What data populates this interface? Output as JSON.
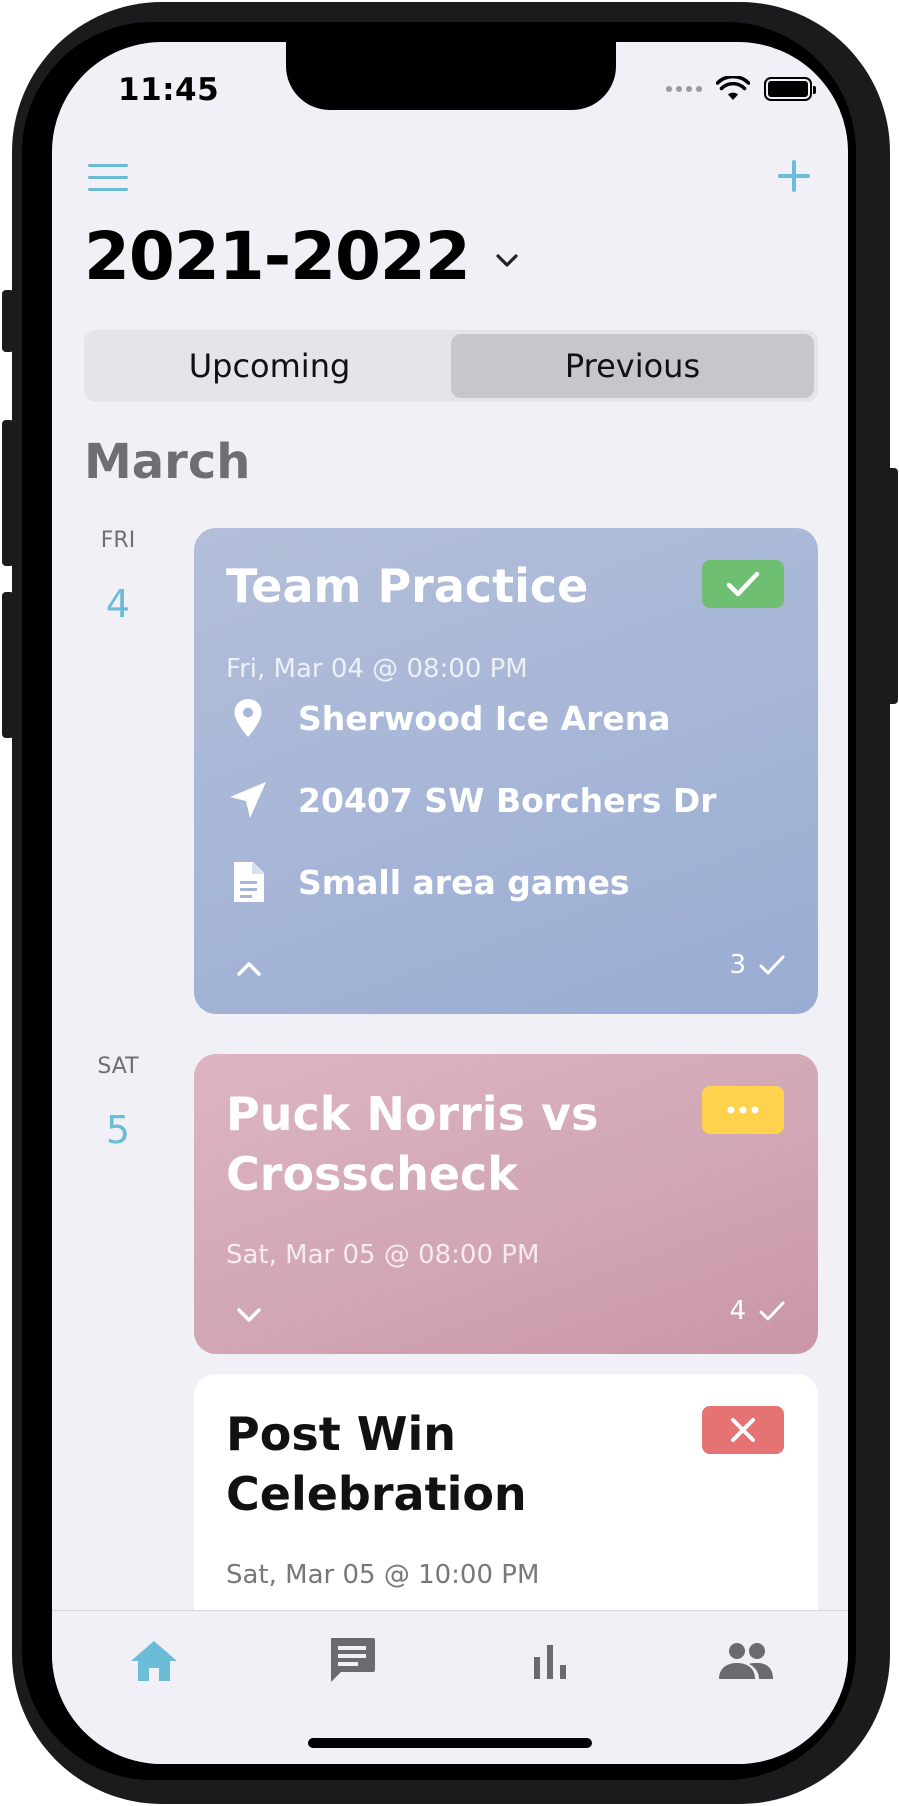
{
  "status_bar": {
    "time": "11:45"
  },
  "header": {
    "season": "2021-2022"
  },
  "segments": {
    "upcoming": "Upcoming",
    "previous": "Previous",
    "selected": "Previous"
  },
  "month": "March",
  "days": [
    {
      "dow": "FRI",
      "day": "4"
    },
    {
      "dow": "SAT",
      "day": "5"
    }
  ],
  "events": [
    {
      "title": "Team Practice",
      "datetime": "Fri, Mar 04 @ 08:00 PM",
      "status": "attending",
      "location": "Sherwood Ice Arena",
      "address": "20407 SW Borchers Dr",
      "notes": "Small area games",
      "count": "3",
      "expanded": true
    },
    {
      "title_line1": "Puck Norris vs",
      "title_line2": "Crosscheck",
      "datetime": "Sat, Mar 05 @ 08:00 PM",
      "status": "pending",
      "count": "4",
      "expanded": false
    },
    {
      "title_line1": "Post Win",
      "title_line2": "Celebration",
      "datetime": "Sat, Mar 05 @ 10:00 PM",
      "status": "declined"
    }
  ],
  "colors": {
    "accent": "#6bbcd6",
    "attending": "#6fbf73",
    "pending": "#ffd24d",
    "declined": "#e57373",
    "practice_card": "#a7b6d7",
    "game_card": "#d1a5b3"
  },
  "tabs": [
    {
      "icon": "home-icon",
      "active": true
    },
    {
      "icon": "chat-icon",
      "active": false
    },
    {
      "icon": "stats-icon",
      "active": false
    },
    {
      "icon": "people-icon",
      "active": false
    }
  ]
}
